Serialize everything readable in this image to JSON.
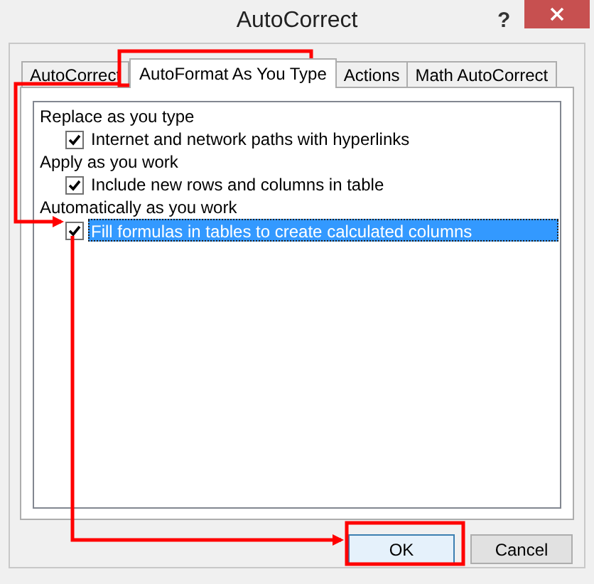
{
  "window": {
    "title": "AutoCorrect",
    "help": "?"
  },
  "tabs": [
    {
      "label": "AutoCorrect",
      "selected": false
    },
    {
      "label": "AutoFormat As You Type",
      "selected": true
    },
    {
      "label": "Actions",
      "selected": false
    },
    {
      "label": "Math AutoCorrect",
      "selected": false
    }
  ],
  "options": [
    {
      "kind": "heading",
      "label": "Replace as you type"
    },
    {
      "kind": "checkbox",
      "label": "Internet and network paths with hyperlinks",
      "checked": true,
      "selected": false
    },
    {
      "kind": "heading",
      "label": "Apply as you work"
    },
    {
      "kind": "checkbox",
      "label": "Include new rows and columns in table",
      "checked": true,
      "selected": false
    },
    {
      "kind": "heading",
      "label": "Automatically as you work"
    },
    {
      "kind": "checkbox",
      "label": "Fill formulas in tables to create calculated columns",
      "checked": true,
      "selected": true
    }
  ],
  "buttons": [
    {
      "label": "OK",
      "default": true
    },
    {
      "label": "Cancel",
      "default": false
    }
  ]
}
